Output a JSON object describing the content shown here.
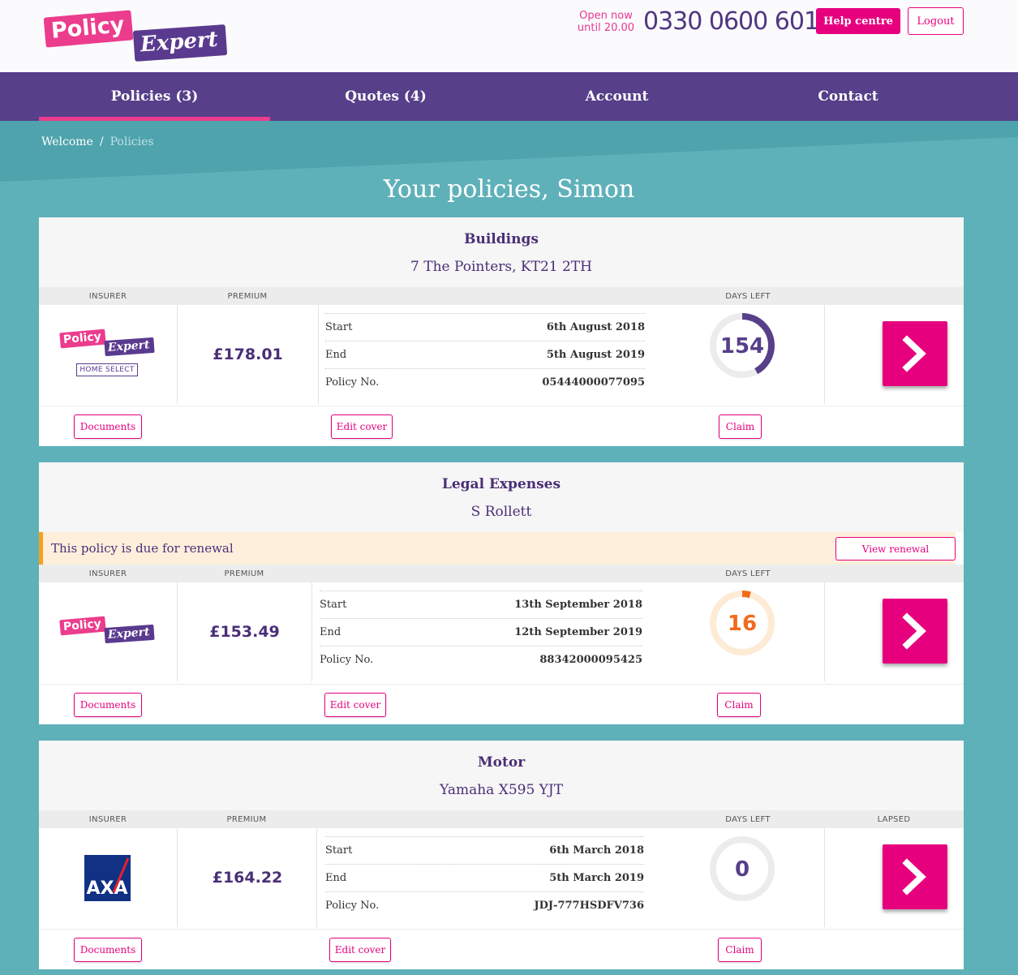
{
  "header": {
    "brand_part1": "Policy",
    "brand_part2": "Expert",
    "open_line1": "Open now",
    "open_line2": "until 20.00",
    "phone": "0330 0600 601",
    "help_label": "Help centre",
    "logout_label": "Logout"
  },
  "nav": {
    "items": [
      {
        "label": "Policies (3)",
        "active": true
      },
      {
        "label": "Quotes (4)",
        "active": false
      },
      {
        "label": "Account",
        "active": false
      },
      {
        "label": "Contact",
        "active": false
      }
    ]
  },
  "breadcrumb": {
    "home": "Welcome",
    "separator": "/",
    "current": "Policies"
  },
  "page_title": "Your policies, Simon",
  "col_headers": {
    "insurer": "INSURER",
    "premium": "PREMIUM",
    "days_left": "DAYS LEFT",
    "lapsed": "LAPSED"
  },
  "labels": {
    "start": "Start",
    "end": "End",
    "policy_no": "Policy No.",
    "documents": "Documents",
    "edit_cover": "Edit cover",
    "claim": "Claim"
  },
  "policies": [
    {
      "type": "Buildings",
      "subtitle": "7 The Pointers, KT21 2TH",
      "insurer_logo": "policy-expert-home-select",
      "insurer_part1": "Policy",
      "insurer_part2": "Expert",
      "insurer_tag": "HOME SELECT",
      "premium": "£178.01",
      "start": "6th August 2018",
      "end": "5th August 2019",
      "policy_no": "05444000077095",
      "days_left": "154",
      "days_fraction": 0.42,
      "gauge_color": "#573f8a"
    },
    {
      "type": "Legal Expenses",
      "subtitle": "S Rollett",
      "renewal_text": "This policy is due for renewal",
      "renewal_button": "View renewal",
      "insurer_logo": "policy-expert",
      "insurer_part1": "Policy",
      "insurer_part2": "Expert",
      "premium": "£153.49",
      "start": "13th September 2018",
      "end": "12th September 2019",
      "policy_no": "88342000095425",
      "days_left": "16",
      "days_fraction": 0.044,
      "gauge_color": "#f26a1b"
    },
    {
      "type": "Motor",
      "subtitle": "Yamaha X595 YJT",
      "insurer_logo": "axa",
      "insurer_name": "AXA",
      "premium": "£164.22",
      "start": "6th March 2018",
      "end": "5th March 2019",
      "policy_no": "JDJ-777HSDFV736",
      "days_left": "0",
      "days_fraction": 0,
      "gauge_color": "#573f8a",
      "status": "LAPSED"
    }
  ],
  "colors": {
    "accent": "#e6007e",
    "nav": "#573f8a",
    "teal": "#5fb1b9"
  }
}
